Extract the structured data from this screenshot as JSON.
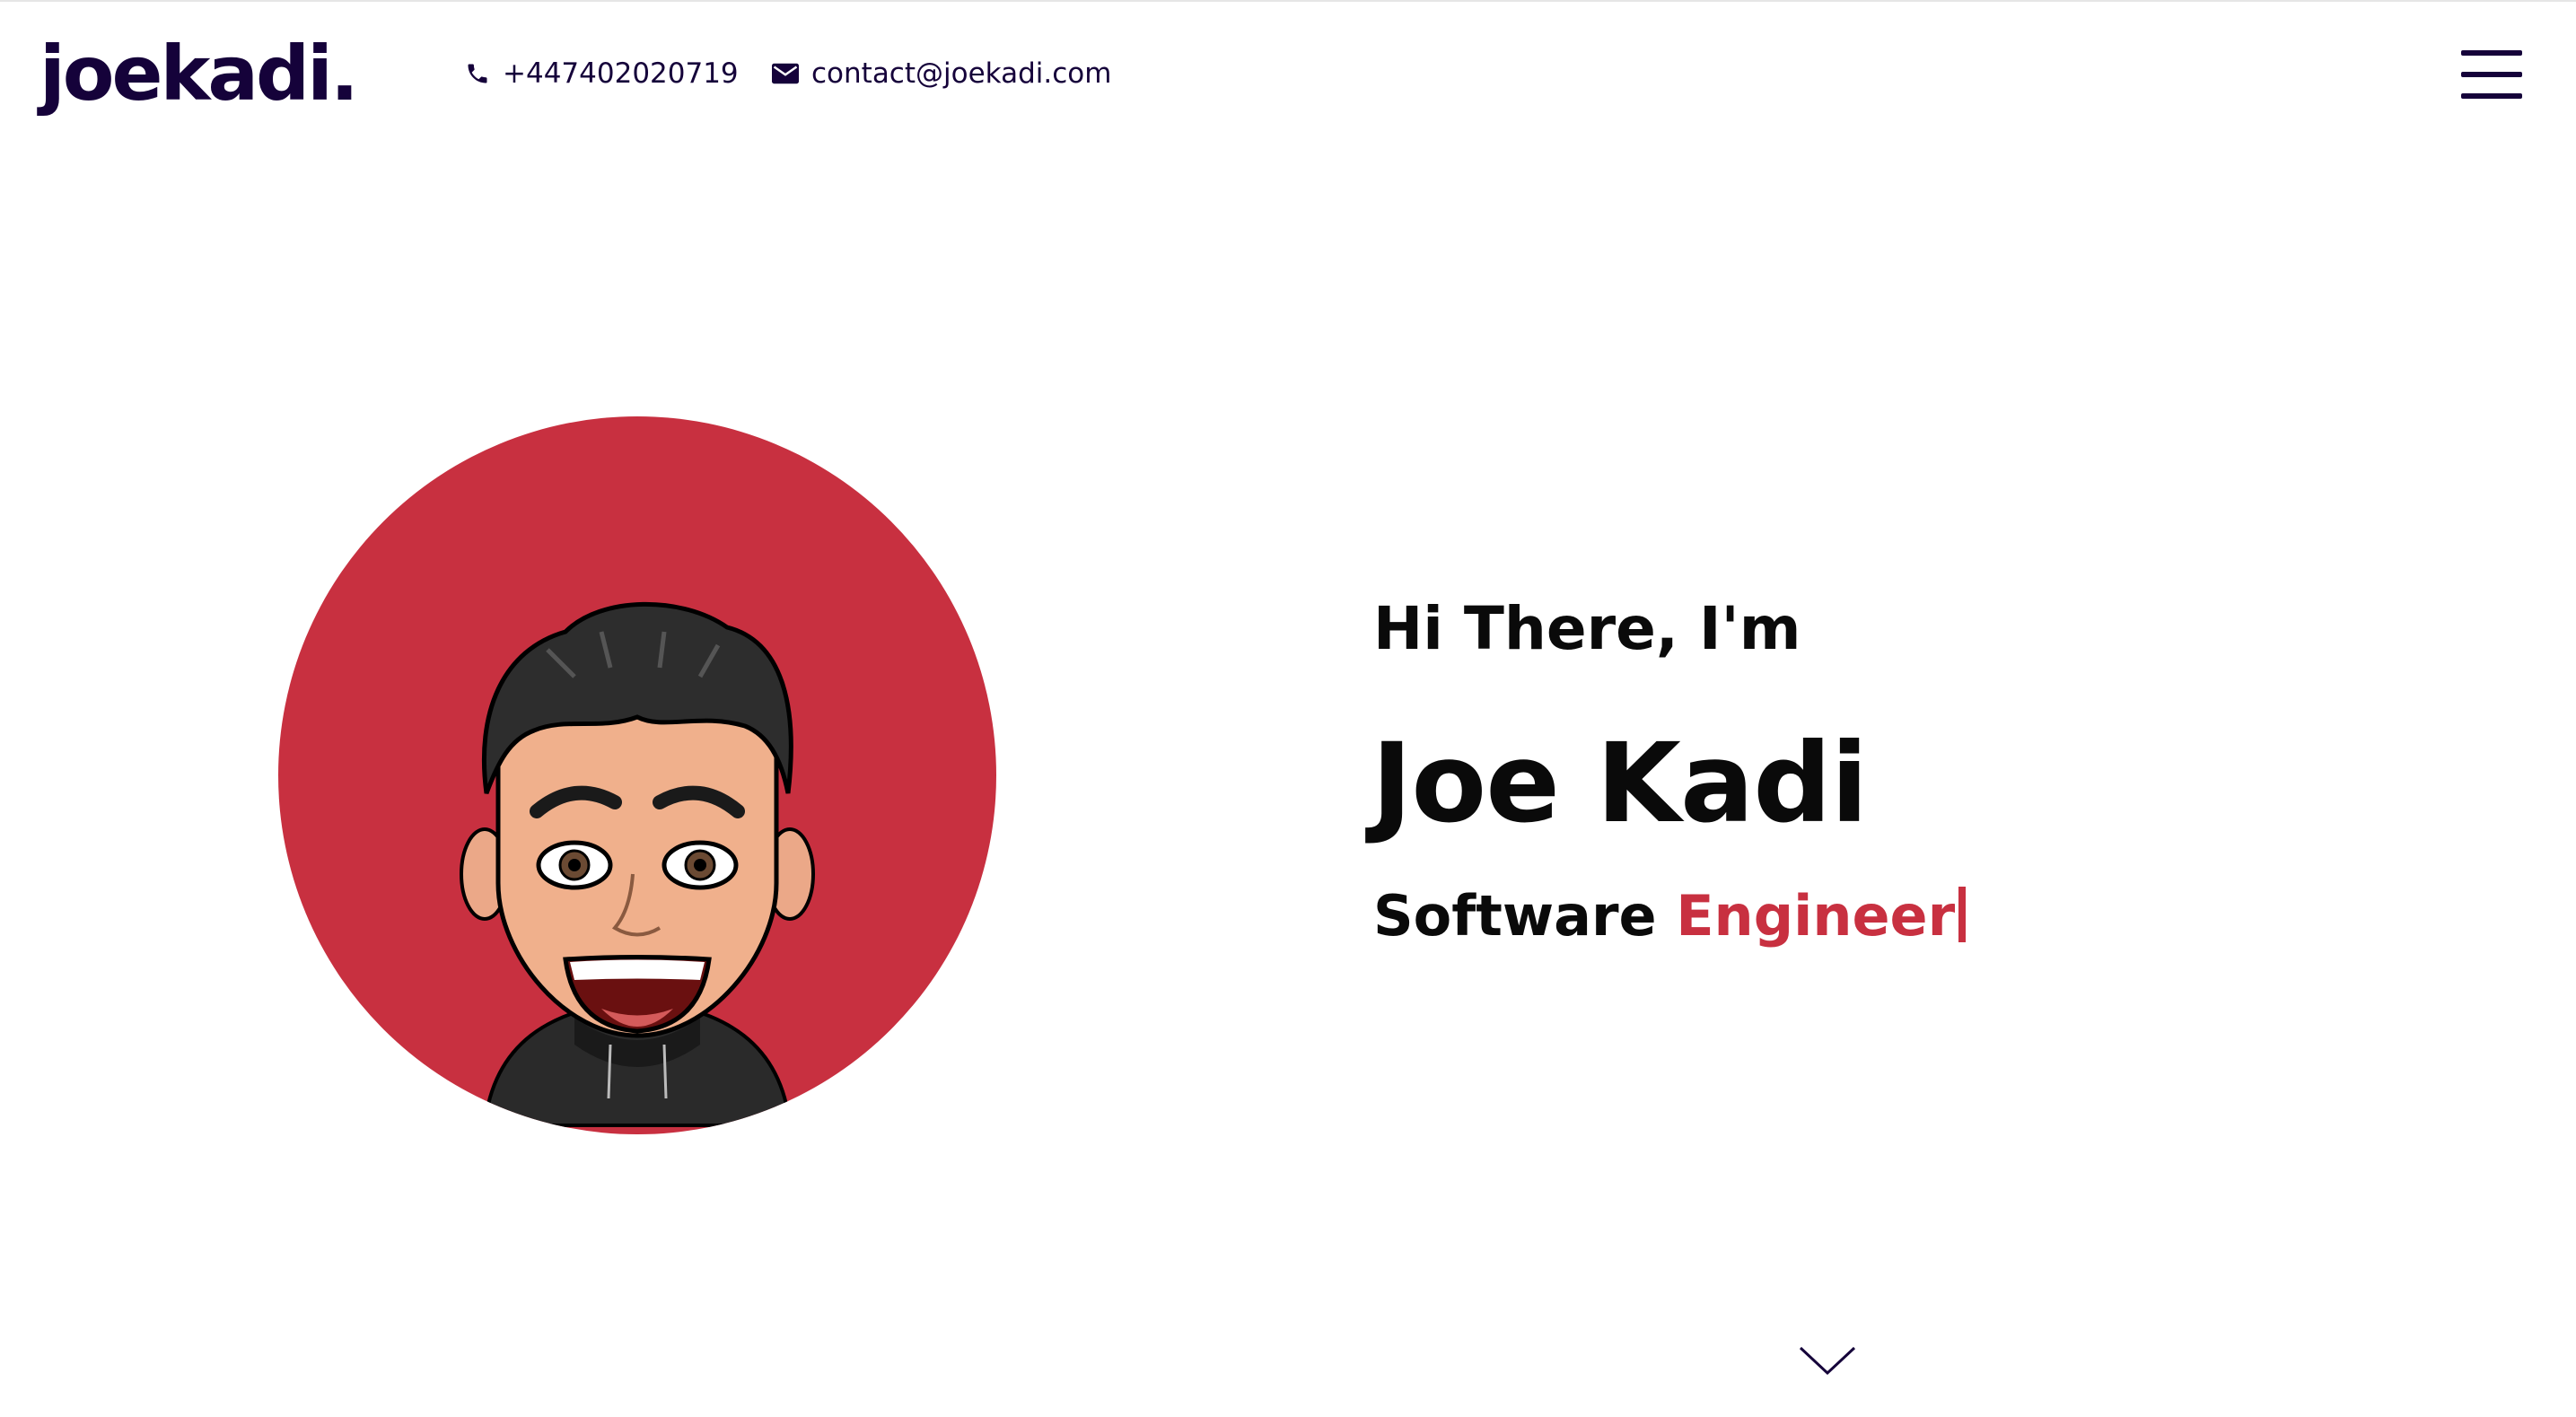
{
  "header": {
    "logo": "joekadi.",
    "phone": "+447402020719",
    "email": "contact@joekadi.com",
    "menu_icon": "hamburger-menu-icon"
  },
  "hero": {
    "greeting": "Hi There, I'm",
    "name": "Joe Kadi",
    "role_prefix": "Software",
    "role_highlight": "Engineer",
    "avatar": "cartoon-avatar"
  },
  "colors": {
    "accent": "#c83040",
    "brand_dark": "#15023a",
    "text": "#0a0a0a",
    "background": "#ffffff"
  }
}
